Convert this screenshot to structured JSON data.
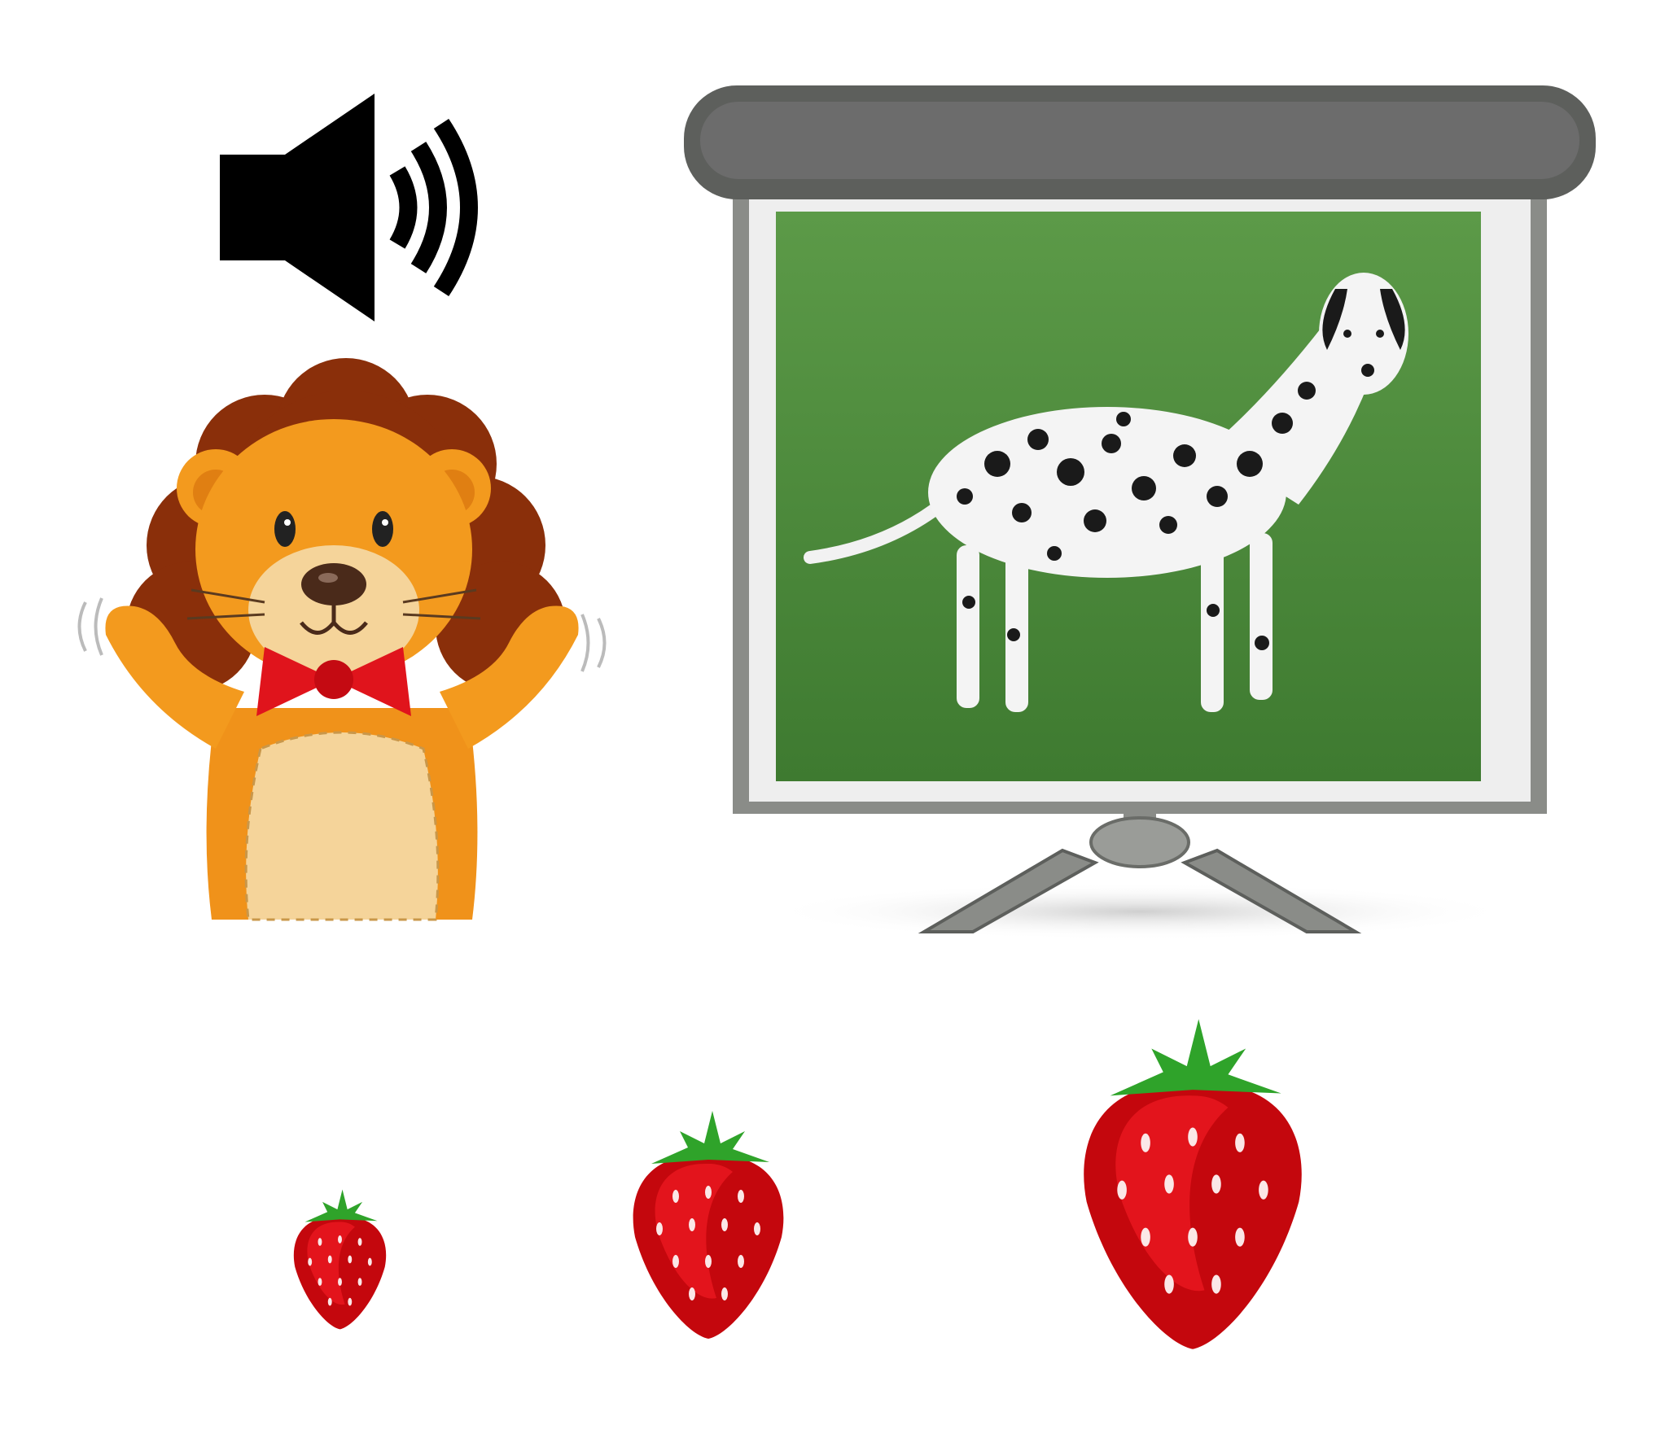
{
  "scene": {
    "items": [
      {
        "name": "speaker",
        "icon": "speaker-volume-icon",
        "color": "#000000"
      },
      {
        "name": "lion",
        "icon": "lion-mascot",
        "colors": {
          "fur": "#f39a1e",
          "mane": "#8a2f0a",
          "belly": "#f5d49a",
          "bowtie": "#e0141c"
        }
      },
      {
        "name": "projector-screen",
        "icon": "projection-screen",
        "content": "dalmatian-dog-photo",
        "colors": {
          "housing": "#5d5f5c",
          "frame": "#8a8c88",
          "grass": "#4b8a3a"
        }
      },
      {
        "name": "strawberry-small",
        "icon": "strawberry-icon",
        "size": "small"
      },
      {
        "name": "strawberry-medium",
        "icon": "strawberry-icon",
        "size": "medium"
      },
      {
        "name": "strawberry-large",
        "icon": "strawberry-icon",
        "size": "large"
      }
    ],
    "colors": {
      "strawberry": "#e3141c",
      "strawberry_dark": "#c4070d",
      "leaf": "#2fa32a"
    }
  }
}
